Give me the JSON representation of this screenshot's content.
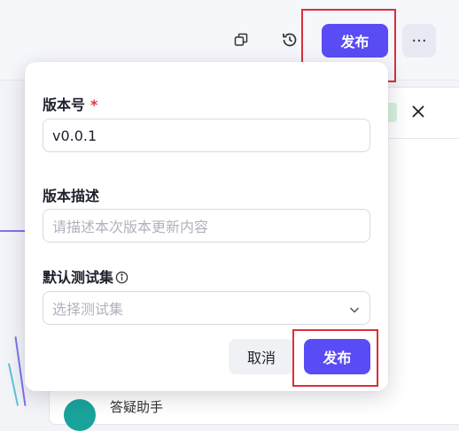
{
  "toolbar": {
    "copy_icon": "copy-icon",
    "history_icon": "history-icon",
    "publish_label": "发布",
    "more_label": "···"
  },
  "background": {
    "close_icon": "close-icon",
    "bottom_text": "答疑助手"
  },
  "form": {
    "version_label": "版本号",
    "required_mark": "*",
    "version_value": "v0.0.1",
    "description_label": "版本描述",
    "description_placeholder": "请描述本次版本更新内容",
    "testset_label": "默认测试集",
    "testset_placeholder": "选择测试集",
    "cancel_label": "取消",
    "publish_label": "发布"
  },
  "colors": {
    "accent": "#5a4cf5",
    "highlight": "#d9303a",
    "required": "#e5343f"
  }
}
